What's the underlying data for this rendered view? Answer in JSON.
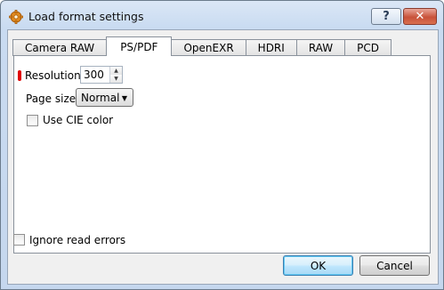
{
  "window": {
    "title": "Load format settings",
    "help_label": "?",
    "close_label": "✕",
    "icon": "settings-gear-icon"
  },
  "tabs": [
    {
      "label": "Camera RAW",
      "active": false
    },
    {
      "label": "PS/PDF",
      "active": true
    },
    {
      "label": "OpenEXR",
      "active": false
    },
    {
      "label": "HDRI",
      "active": false
    },
    {
      "label": "RAW",
      "active": false
    },
    {
      "label": "PCD",
      "active": false
    }
  ],
  "panel": {
    "resolution_label": "Resolution",
    "resolution_value": "300",
    "page_size_label": "Page size",
    "page_size_value": "Normal",
    "cie_label": "Use CIE color",
    "cie_checked": false
  },
  "footer": {
    "ignore_label": "Ignore read errors",
    "ignore_checked": false,
    "ok_label": "OK",
    "cancel_label": "Cancel"
  },
  "colors": {
    "required_marker": "#e00000",
    "close_button": "#c8523a"
  }
}
